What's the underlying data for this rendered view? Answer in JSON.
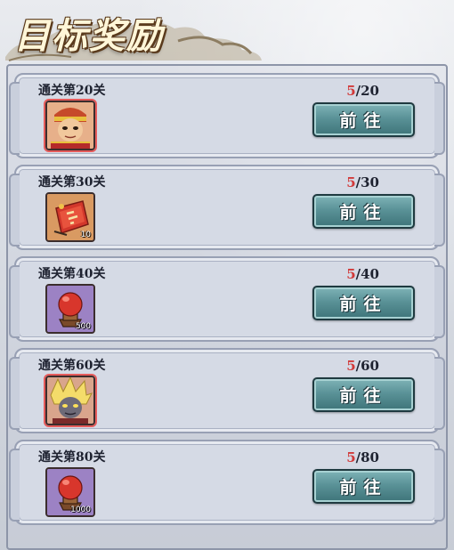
{
  "header": {
    "title": "目标奖励"
  },
  "rewards": [
    {
      "title": "通关第20关",
      "current": "5",
      "target": "/20",
      "button": "前往",
      "icon": "monkey-king-avatar-icon",
      "quantity": ""
    },
    {
      "title": "通关第30关",
      "current": "5",
      "target": "/30",
      "button": "前往",
      "icon": "red-fan-token-icon",
      "quantity": "10"
    },
    {
      "title": "通关第40关",
      "current": "5",
      "target": "/40",
      "button": "前往",
      "icon": "red-orb-pedestal-icon",
      "quantity": "500"
    },
    {
      "title": "通关第60关",
      "current": "5",
      "target": "/60",
      "button": "前往",
      "icon": "blond-demon-avatar-icon",
      "quantity": ""
    },
    {
      "title": "通关第80关",
      "current": "5",
      "target": "/80",
      "button": "前往",
      "icon": "red-orb-pedestal-icon",
      "quantity": "1000"
    }
  ],
  "colors": {
    "progress_current": "#d23a3a",
    "button": "#5a9297"
  }
}
